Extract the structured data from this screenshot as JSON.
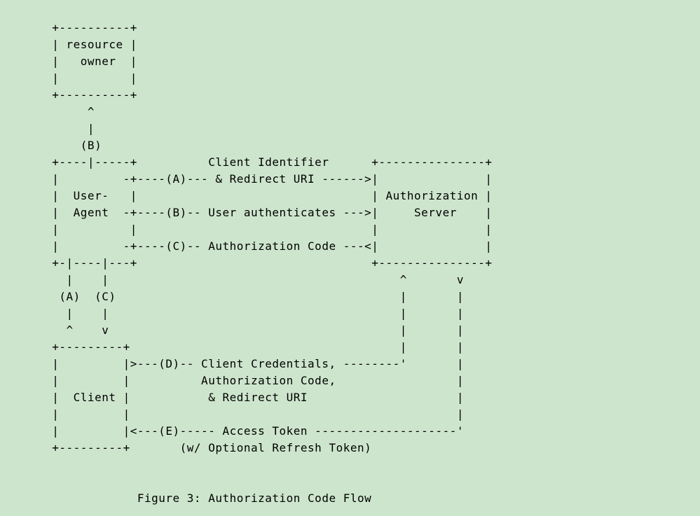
{
  "figure": {
    "caption": "Figure 3: Authorization Code Flow",
    "entities": {
      "resource_owner": "resource\n   owner",
      "user_agent": "User-\nAgent",
      "authorization_server": "Authorization\n    Server",
      "client": "Client"
    },
    "steps": {
      "A": "Client Identifier & Redirect URI",
      "B_up": "(B)",
      "B": "User authenticates",
      "C": "Authorization Code",
      "D": "Client Credentials, Authorization Code, & Redirect URI",
      "E": "Access Token (w/ Optional Refresh Token)"
    }
  },
  "ascii": "  +----------+\n  | resource |\n  |   owner  |\n  |          |\n  +----------+\n       ^\n       |\n      (B)\n  +----|-----+          Client Identifier      +---------------+\n  |         -+----(A)--- & Redirect URI ------>|               |\n  |  User-   |                                 | Authorization |\n  |  Agent  -+----(B)-- User authenticates --->|     Server    |\n  |          |                                 |               |\n  |         -+----(C)-- Authorization Code ---<|               |\n  +-|----|---+                                 +---------------+\n    |    |                                         ^       v\n   (A)  (C)                                        |       |\n    |    |                                         |       |\n    ^    v                                         |       |\n  +---------+                                      |       |\n  |         |>---(D)-- Client Credentials, --------'       |\n  |         |          Authorization Code,                 |\n  |  Client |           & Redirect URI                     |\n  |         |                                              |\n  |         |<---(E)----- Access Token --------------------'\n  +---------+       (w/ Optional Refresh Token)\n\n\n              Figure 3: Authorization Code Flow"
}
